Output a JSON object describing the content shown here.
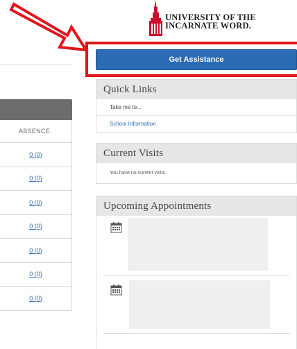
{
  "logo": {
    "line1": "UNIVERSITY OF THE",
    "line2": "INCARNATE WORD.",
    "color": "#c8102e"
  },
  "annotation": {
    "arrow_color": "#e0161b",
    "highlight_color": "#e0161b"
  },
  "left_table": {
    "column_header": "ABSENCE",
    "rows": [
      "0 (0)",
      "0 (0)",
      "0 (0)",
      "0 (0)",
      "0 (0)",
      "0 (0)",
      "0 (0)"
    ]
  },
  "assist_button": {
    "label": "Get Assistance",
    "color": "#2b6cb5"
  },
  "quick_links": {
    "title": "Quick Links",
    "items": [
      "Take me to...",
      "School Information"
    ]
  },
  "current_visits": {
    "title": "Current Visits",
    "message": "You have no current visits."
  },
  "upcoming": {
    "title": "Upcoming Appointments",
    "icon": "calendar-icon"
  }
}
